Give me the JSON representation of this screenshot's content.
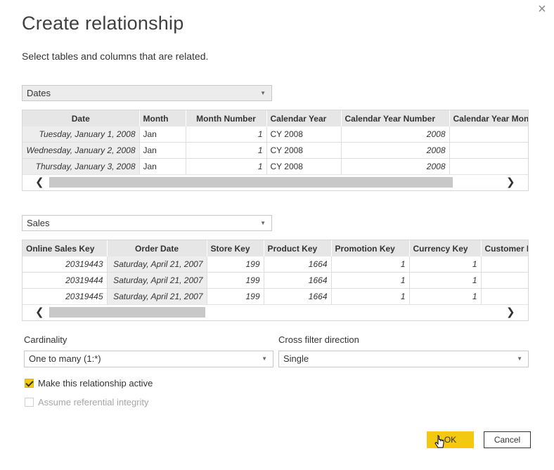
{
  "dialog": {
    "title": "Create relationship",
    "subtitle": "Select tables and columns that are related.",
    "close_glyph": "×"
  },
  "table1": {
    "name": "Dates",
    "columns": [
      "Date",
      "Month",
      "Month Number",
      "Calendar Year",
      "Calendar Year Number",
      "Calendar Year Mon"
    ],
    "rows": [
      [
        "Tuesday, January 1, 2008",
        "Jan",
        "1",
        "CY 2008",
        "2008",
        ""
      ],
      [
        "Wednesday, January 2, 2008",
        "Jan",
        "1",
        "CY 2008",
        "2008",
        ""
      ],
      [
        "Thursday, January 3, 2008",
        "Jan",
        "1",
        "CY 2008",
        "2008",
        ""
      ]
    ]
  },
  "table2": {
    "name": "Sales",
    "columns": [
      "Online Sales Key",
      "Order Date",
      "Store Key",
      "Product Key",
      "Promotion Key",
      "Currency Key",
      "Customer K"
    ],
    "rows": [
      [
        "20319443",
        "Saturday, April 21, 2007",
        "199",
        "1664",
        "1",
        "1",
        ""
      ],
      [
        "20319444",
        "Saturday, April 21, 2007",
        "199",
        "1664",
        "1",
        "1",
        ""
      ],
      [
        "20319445",
        "Saturday, April 21, 2007",
        "199",
        "1664",
        "1",
        "1",
        ""
      ]
    ]
  },
  "scroll": {
    "left_glyph": "❮",
    "right_glyph": "❯"
  },
  "cardinality": {
    "label": "Cardinality",
    "value": "One to many (1:*)"
  },
  "cross_filter": {
    "label": "Cross filter direction",
    "value": "Single"
  },
  "options": {
    "active_label": "Make this relationship active",
    "active_checked": true,
    "integrity_label": "Assume referential integrity",
    "integrity_checked": false
  },
  "buttons": {
    "ok": "OK",
    "cancel": "Cancel"
  },
  "colors": {
    "accent": "#f2c811",
    "header_bg": "#e6e6e6",
    "dropdown_bg": "#ececec"
  }
}
